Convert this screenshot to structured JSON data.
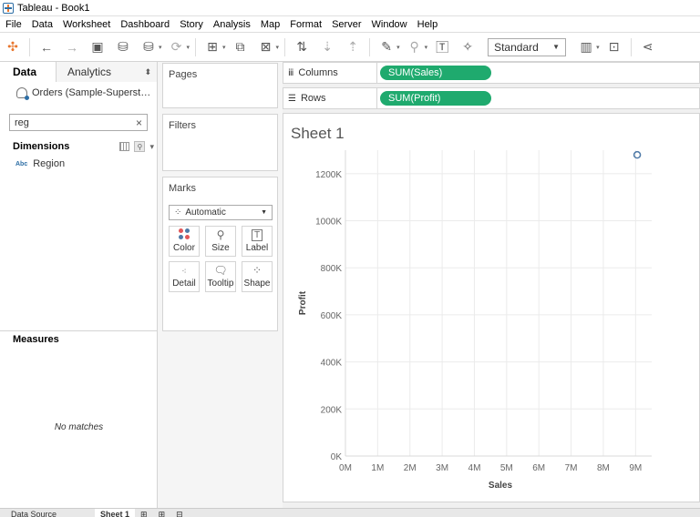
{
  "window": {
    "title": "Tableau - Book1"
  },
  "menu": [
    "File",
    "Data",
    "Worksheet",
    "Dashboard",
    "Story",
    "Analysis",
    "Map",
    "Format",
    "Server",
    "Window",
    "Help"
  ],
  "toolbar": {
    "fit_select": "Standard"
  },
  "data_pane": {
    "tab_data": "Data",
    "tab_analytics": "Analytics",
    "datasource": "Orders (Sample-Superst…",
    "search_value": "reg",
    "dimensions_label": "Dimensions",
    "dimension_field_type": "Abc",
    "dimension_field": "Region",
    "measures_label": "Measures",
    "measures_empty": "No matches"
  },
  "cards": {
    "pages": "Pages",
    "filters": "Filters",
    "marks": "Marks",
    "mark_type": "Automatic",
    "marks_buttons": {
      "color": "Color",
      "size": "Size",
      "label": "Label",
      "detail": "Detail",
      "tooltip": "Tooltip",
      "shape": "Shape"
    }
  },
  "shelves": {
    "columns_label": "Columns",
    "columns_pill": "SUM(Sales)",
    "rows_label": "Rows",
    "rows_pill": "SUM(Profit)"
  },
  "sheet": {
    "title": "Sheet 1"
  },
  "bottom_tabs": {
    "datasource": "Data Source",
    "sheet": "Sheet 1"
  },
  "chart_data": {
    "type": "scatter",
    "xlabel": "Sales",
    "ylabel": "Profit",
    "x_ticks": [
      "0M",
      "1M",
      "2M",
      "3M",
      "4M",
      "5M",
      "6M",
      "7M",
      "8M",
      "9M"
    ],
    "y_ticks": [
      "0K",
      "200K",
      "400K",
      "600K",
      "800K",
      "1000K",
      "1200K"
    ],
    "xlim": [
      0,
      9500000
    ],
    "ylim": [
      0,
      1300000
    ],
    "points": [
      {
        "x": 9050000,
        "y": 1280000
      }
    ],
    "grid": true,
    "mark_color": "#4e79a7"
  }
}
